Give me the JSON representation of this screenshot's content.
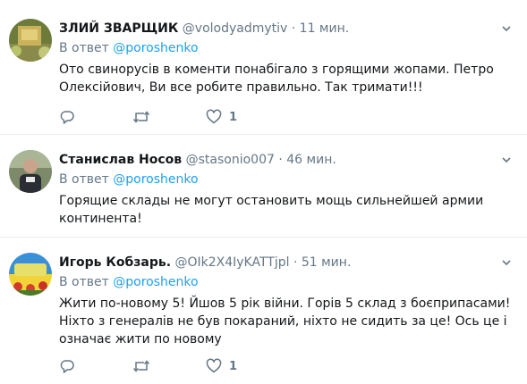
{
  "tweets": [
    {
      "name": "ЗЛИЙ ЗВАРЩИК",
      "handle": "@volodyadmytiv",
      "dot": "·",
      "time": "11 мин.",
      "reply_prefix": "В ответ ",
      "reply_to": "@poroshenko",
      "text": "Ото свинорусів в коменти понабігало з горящими жопами. Петро Олексійович, Ви все робите правильно. Так тримати!!!",
      "like_count": "1"
    },
    {
      "name": "Станислав Носов",
      "handle": "@stasonio007",
      "dot": "·",
      "time": "46 мин.",
      "reply_prefix": "В ответ ",
      "reply_to": "@poroshenko",
      "text": "Горящие склады не могут остановить мощь сильнейшей армии континента!"
    },
    {
      "name": "Игорь Кобзарь.",
      "handle": "@OIk2X4IyKATTjpl",
      "dot": "·",
      "time": "51 мин.",
      "reply_prefix": "В ответ ",
      "reply_to": "@poroshenko",
      "text": "Жити по-новому 5! Йшов 5 рік війни. Горів 5 склад з боєприпасами! Ніхто з генералів не був покараний, ніхто не сидить за це! Ось це і означає жити по новому",
      "like_count": "1"
    }
  ],
  "colors": {
    "text": "#14171a",
    "secondary": "#657786",
    "link": "#1da1f2",
    "divider": "#e6ecf0"
  },
  "icons": [
    "reply-icon",
    "retweet-icon",
    "like-icon",
    "chevron-down-icon"
  ]
}
